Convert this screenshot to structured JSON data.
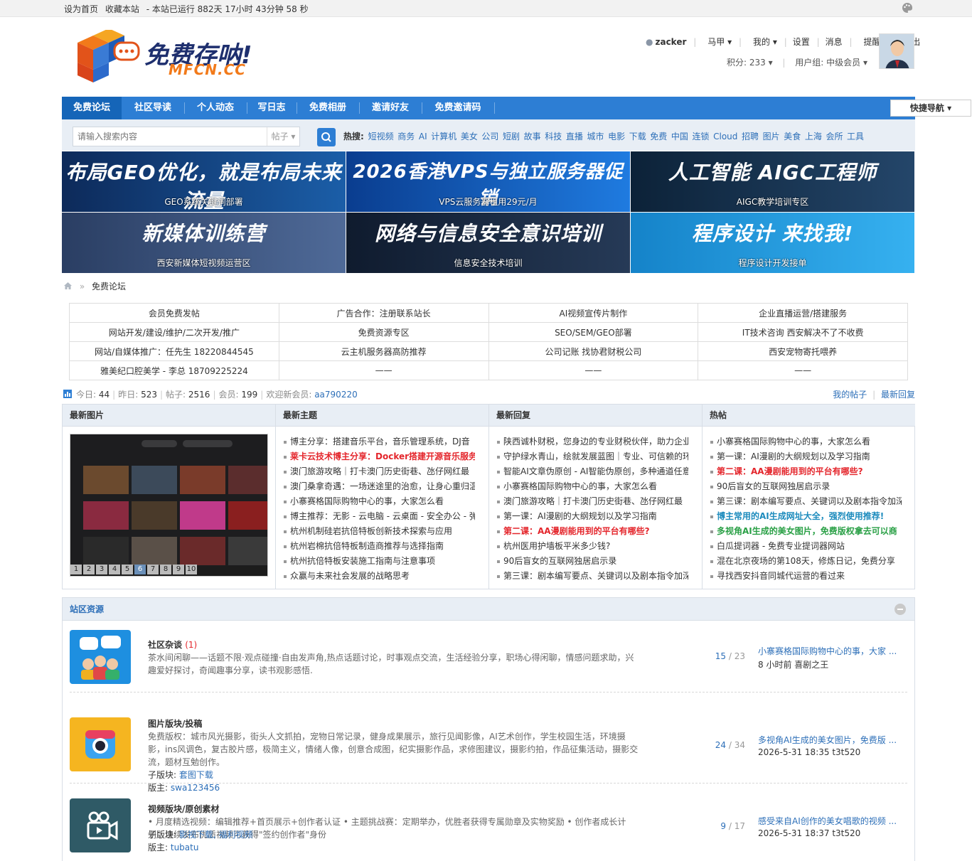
{
  "topbar": {
    "set_home": "设为首页",
    "bookmark": "收藏本站",
    "uptime": "- 本站已运行 882天 17小时 43分钟 58 秒"
  },
  "header": {
    "logo_cn": "免费存呐!",
    "logo_en": "MFCN.CC",
    "user": {
      "username": "zacker",
      "menus": [
        "马甲",
        "我的",
        "设置",
        "消息",
        "提醒",
        "退出"
      ],
      "points": "积分: 233",
      "group": "用户组: 中级会员"
    }
  },
  "nav": {
    "items": [
      "免费论坛",
      "社区导读",
      "个人动态",
      "写日志",
      "免费相册",
      "邀请好友",
      "免费邀请码"
    ],
    "quick_nav": "快捷导航"
  },
  "search": {
    "placeholder": "请输入搜索内容",
    "type": "帖子",
    "hot_label": "热搜:",
    "hot_words": [
      "短视频",
      "商务",
      "AI",
      "计算机",
      "美女",
      "公司",
      "短剧",
      "故事",
      "科技",
      "直播",
      "城市",
      "电影",
      "下载",
      "免费",
      "中国",
      "连锁",
      "Cloud",
      "招聘",
      "图片",
      "美食",
      "上海",
      "会所",
      "工具"
    ]
  },
  "banners": [
    {
      "headline": "布局GEO优化，就是布局未来流量",
      "caption": "GEO系统关键词部署",
      "color1": "#0d2a5a",
      "color2": "#1b5ea8"
    },
    {
      "headline": "2026香港VPS与独立服务器促销",
      "caption": "VPS云服务器租用29元/月",
      "color1": "#0a3d8f",
      "color2": "#1f7be0"
    },
    {
      "headline": "人工智能 AIGC工程师",
      "caption": "AIGC教学培训专区",
      "color1": "#0c2238",
      "color2": "#24466a"
    },
    {
      "headline": "新媒体训练营",
      "caption": "西安新媒体短视频运营区",
      "color1": "#2a3e63",
      "color2": "#4f6a98"
    },
    {
      "headline": "网络与信息安全意识培训",
      "caption": "信息安全技术培训",
      "color1": "#0f1b2e",
      "color2": "#263a57"
    },
    {
      "headline": "程序设计 来找我!",
      "caption": "程序设计开发接单",
      "color1": "#1583c9",
      "color2": "#36b1f0"
    }
  ],
  "breadcrumb": {
    "current": "免费论坛"
  },
  "ad_table": [
    [
      "会员免费发帖",
      "广告合作：注册联系站长",
      "AI视频宣传片制作",
      "企业直播运营/搭建服务"
    ],
    [
      "网站开发/建设/维护/二次开发/推广",
      "免费资源专区",
      "SEO/SEM/GEO部署",
      "IT技术咨询 西安解决不了不收费"
    ],
    [
      "网站/自媒体推广：任先生 18220844545",
      "云主机服务器高防推荐",
      "公司记账 找协君财税公司",
      "西安宠物寄托喂养"
    ],
    [
      "雅美纪口腔美学 - 李总 18709225224",
      "——",
      "——",
      "——"
    ]
  ],
  "stats": {
    "today_label": "今日:",
    "today": "44",
    "yesterday_label": "昨日:",
    "yesterday": "523",
    "posts_label": "帖子:",
    "posts": "2516",
    "members_label": "会员:",
    "members": "199",
    "welcome_label": "欢迎新会员:",
    "new_member": "aa790220",
    "my_posts": "我的帖子",
    "latest_reply": "最新回复"
  },
  "grid": {
    "col1_title": "最新图片",
    "pager": [
      "1",
      "2",
      "3",
      "4",
      "5",
      "6",
      "7",
      "8",
      "9",
      "10"
    ],
    "col2_title": "最新主题",
    "col2": [
      {
        "t": "博主分享：搭建音乐平台，音乐管理系统，DJ音",
        "s": ""
      },
      {
        "t": "莱卡云技术博主分享：Docker搭建开源音乐服务",
        "s": "red"
      },
      {
        "t": "澳门旅游攻略｜打卡澳门历史街巷、氹仔网红最",
        "s": ""
      },
      {
        "t": "澳门桑拿奇遇：一场迷途里的治愈，让身心重归温",
        "s": ""
      },
      {
        "t": "小寨赛格国际购物中心的事，大家怎么看",
        "s": ""
      },
      {
        "t": "博主推荐：无影 - 云电脑 - 云桌面 - 安全办公 - 弹",
        "s": ""
      },
      {
        "t": "杭州机制硅岩抗倍特板创新技术探索与应用",
        "s": ""
      },
      {
        "t": "杭州岩棉抗倍特板制造商推荐与选择指南",
        "s": ""
      },
      {
        "t": "杭州抗倍特板安装施工指南与注意事项",
        "s": ""
      },
      {
        "t": "众赢与未来社会发展的战略思考",
        "s": ""
      }
    ],
    "col3_title": "最新回复",
    "col3": [
      {
        "t": "陕西诚朴财税，您身边的专业财税伙伴，助力企业",
        "s": ""
      },
      {
        "t": "守护绿水青山，绘就发展蓝图｜专业、可信赖的环",
        "s": ""
      },
      {
        "t": "智能AI文章伪原创 - AI智能伪原创，多种通道任意",
        "s": ""
      },
      {
        "t": "小寨赛格国际购物中心的事，大家怎么看",
        "s": ""
      },
      {
        "t": "澳门旅游攻略｜打卡澳门历史街巷、氹仔网红最",
        "s": ""
      },
      {
        "t": "第一课：AI漫剧的大纲规划以及学习指南",
        "s": ""
      },
      {
        "t": "第二课：AA漫剧能用到的平台有哪些?",
        "s": "red"
      },
      {
        "t": "杭州医用护墙板平米多少钱?",
        "s": ""
      },
      {
        "t": "90后盲女的互联网独居启示录",
        "s": ""
      },
      {
        "t": "第三课：剧本编写要点、关键词以及剧本指令加深",
        "s": ""
      }
    ],
    "col4_title": "热帖",
    "col4": [
      {
        "t": "小寨赛格国际购物中心的事，大家怎么看",
        "s": ""
      },
      {
        "t": "第一课：AI漫剧的大纲规划以及学习指南",
        "s": ""
      },
      {
        "t": "第二课：AA漫剧能用到的平台有哪些?",
        "s": "red"
      },
      {
        "t": "90后盲女的互联网独居启示录",
        "s": ""
      },
      {
        "t": "第三课：剧本编写要点、关键词以及剧本指令加深",
        "s": ""
      },
      {
        "t": "博主常用的AI生成网址大全，强烈使用推荐!",
        "s": "blue"
      },
      {
        "t": "多视角AI生成的美女图片，免费版权拿去可以商",
        "s": "green"
      },
      {
        "t": "白瓜提词器 - 免费专业提词器网站",
        "s": ""
      },
      {
        "t": "混在北京夜场的第108天，修炼日记，免费分享",
        "s": ""
      },
      {
        "t": "寻找西安抖音同城代运营的看过来",
        "s": ""
      }
    ]
  },
  "forum": {
    "title": "站区资源",
    "rows": [
      {
        "name": "社区杂谈",
        "count": "(1)",
        "desc": "茶水间闲聊——话题不限·观点碰撞·自由发声角,热点话题讨论，时事观点交流，生活经验分享，职场心得闲聊，情感问题求助，兴趣爱好探讨，奇闻趣事分享，读书观影感悟.",
        "sub_label": "",
        "sub": "",
        "mod_label": "",
        "mod": "",
        "threads": "15",
        "posts": "23",
        "last_title": "小寨赛格国际购物中心的事，大家 ...",
        "last_info": "8 小时前 喜剧之王",
        "icon_bg": "#1e8fe0"
      },
      {
        "name": "图片版块/投稿",
        "count": "",
        "desc": "免费版权：城市风光摄影，街头人文抓拍，宠物日常记录，健身成果展示，旅行见闻影像，AI艺术创作，学生校园生活，环境摄影，ins风调色，复古胶片感，极简主义，情绪人像，创意合成图，纪实摄影作品，求修图建议，摄影约拍，作品征集活动，摄影交流，题材互勉创作。",
        "sub_label": "子版块:",
        "sub": "套图下载",
        "mod_label": "版主:",
        "mod": "swa123456",
        "threads": "24",
        "posts": "34",
        "last_title": "多视角AI生成的美女图片，免费版 ...",
        "last_info": "2026-5-31 18:35 t3t520",
        "icon_bg": "#f5b520"
      },
      {
        "name": "视频版块/原创素材",
        "count": "",
        "desc": "• 月度精选视频：编辑推荐+首页展示+创作者认证 • 主题挑战赛：定期举办，优胜者获得专属勋章及实物奖励 • 创作者成长计划：连续发布优质视频可获得\"签约创作者\"身份",
        "sub_label": "子版块:",
        "sub": "影视下载, 福利视频",
        "mod_label": "版主:",
        "mod": "tubatu",
        "threads": "9",
        "posts": "17",
        "last_title": "感受来自AI创作的美女唱歌的视频 ...",
        "last_info": "2026-5-31 18:37 t3t520",
        "icon_bg": "#2f5a66"
      }
    ]
  }
}
